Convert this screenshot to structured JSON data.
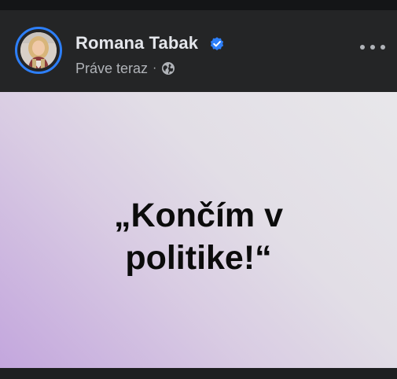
{
  "post": {
    "author_name": "Romana Tabak",
    "verified": true,
    "timestamp": "Práve teraz",
    "separator": "·",
    "audience_icon": "globe-icon",
    "more_icon": "more-options-icon",
    "text_line_1": "„Končím v",
    "text_line_2": "politike!“"
  },
  "colors": {
    "header_bg": "#242526",
    "name_text": "#e4e6eb",
    "meta_text": "#b0b3b8",
    "verified_badge": "#2d7ff9",
    "avatar_ring": "#2d7ff9",
    "gradient_light": "#e8e7ea",
    "gradient_purple": "#c3a6dd",
    "post_text": "#0b0b0b"
  }
}
